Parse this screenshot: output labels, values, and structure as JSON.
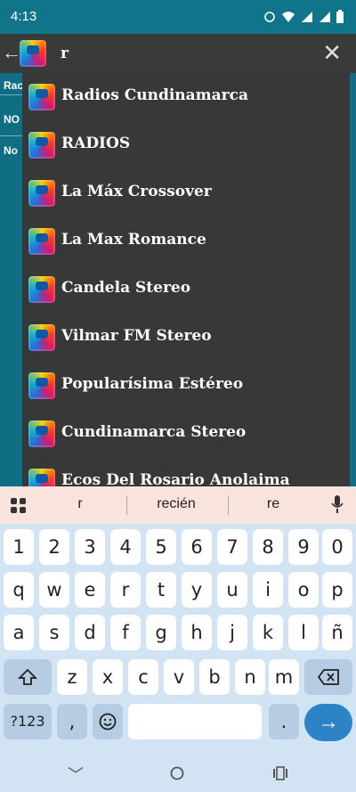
{
  "status_bar": {
    "time": "4:13"
  },
  "toolbar": {
    "search_query": "r"
  },
  "background_rows": [
    {
      "text": "Rac"
    },
    {
      "text": "NO"
    },
    {
      "text": "No"
    }
  ],
  "results": [
    {
      "label": "Radios Cundinamarca"
    },
    {
      "label": "RADIOS"
    },
    {
      "label": "La Máx Crossover"
    },
    {
      "label": " La Max Romance"
    },
    {
      "label": "Candela Stereo"
    },
    {
      "label": "Vilmar FM Stereo"
    },
    {
      "label": "Popularísima Estéreo"
    },
    {
      "label": "Cundinamarca Stereo"
    },
    {
      "label": "Ecos Del Rosario Anolaima"
    }
  ],
  "keyboard": {
    "suggestions": [
      "r",
      "recién",
      "re"
    ],
    "row_numbers": [
      "1",
      "2",
      "3",
      "4",
      "5",
      "6",
      "7",
      "8",
      "9",
      "0"
    ],
    "row_q": [
      "q",
      "w",
      "e",
      "r",
      "t",
      "y",
      "u",
      "i",
      "o",
      "p"
    ],
    "row_a": [
      "a",
      "s",
      "d",
      "f",
      "g",
      "h",
      "j",
      "k",
      "l",
      "ñ"
    ],
    "row_z": [
      "z",
      "x",
      "c",
      "v",
      "b",
      "n",
      "m"
    ],
    "symbols_label": "?123",
    "comma": ",",
    "period": "."
  }
}
